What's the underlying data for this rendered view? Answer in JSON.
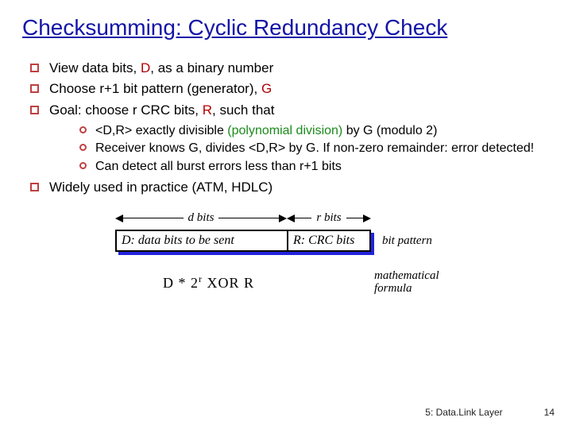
{
  "title": "Checksumming: Cyclic Redundancy Check",
  "bullets": {
    "b1a": "View data bits, ",
    "b1b": "D",
    "b1c": ", as a binary number",
    "b2a": "Choose r+1 bit pattern (generator), ",
    "b2b": "G",
    "b3a": "Goal: choose r CRC bits, ",
    "b3b": "R",
    "b3c": ", such that",
    "s1a": "<D,R> exactly divisible ",
    "s1b": "(polynomial division)",
    "s1c": " by G (modulo 2)",
    "s2": "Receiver knows G, divides <D,R> by G.  If non-zero remainder: error detected!",
    "s3": "Can detect all burst errors less than r+1 bits",
    "b4": "Widely used in practice (ATM, HDLC)"
  },
  "diagram": {
    "d_bits": "d bits",
    "r_bits": "r bits",
    "d_box": "D: data bits to be sent",
    "r_box": "R: CRC bits",
    "bit_pattern": "bit pattern",
    "formula": "D * 2",
    "formula_sup": "r",
    "formula_tail": "   XOR   R",
    "math_label": "mathematical formula"
  },
  "footer": {
    "section": "5: Data.Link Layer",
    "page": "14"
  }
}
